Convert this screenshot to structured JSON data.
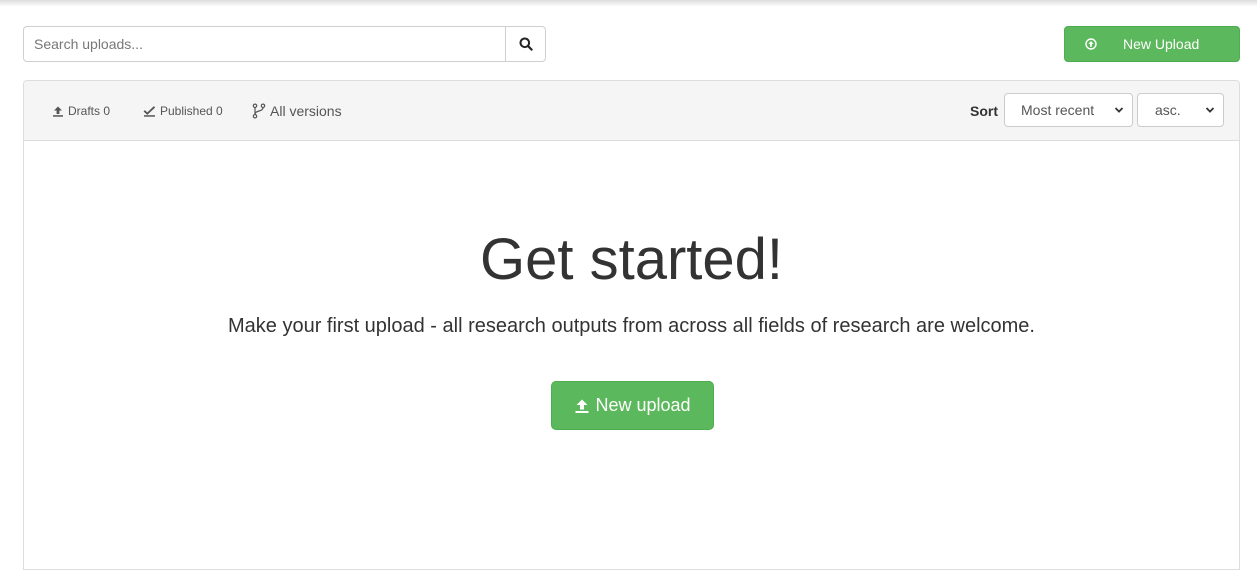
{
  "search": {
    "placeholder": "Search uploads...",
    "button_icon": "search-icon"
  },
  "top_button": {
    "label": "New Upload",
    "icon": "upload-circle-icon",
    "color": "#5cb85c"
  },
  "filters": [
    {
      "icon": "upload-icon",
      "label": "Drafts 0"
    },
    {
      "icon": "check-icon",
      "label": "Published 0"
    },
    {
      "icon": "branch-icon",
      "label": "All versions"
    }
  ],
  "sort": {
    "label": "Sort",
    "field_selected": "Most recent",
    "order_selected": "asc."
  },
  "empty_state": {
    "title": "Get started!",
    "subtitle": "Make your first upload - all research outputs from across all fields of research are welcome.",
    "button_label": "New upload",
    "button_icon": "upload-icon"
  }
}
